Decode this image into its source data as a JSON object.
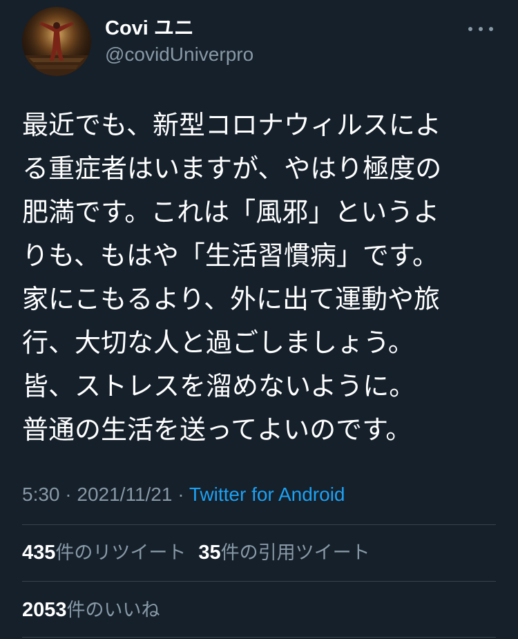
{
  "user": {
    "display_name": "Covi ユニ",
    "handle": "@covidUniverpro"
  },
  "tweet": {
    "lines": [
      "最近でも、新型コロナウィルスによ",
      "る重症者はいますが、やはり極度の",
      "肥満です。これは「風邪」というよ",
      "りも、もはや「生活習慣病」です。",
      "家にこもるより、外に出て運動や旅",
      "行、大切な人と過ごしましょう。",
      "皆、ストレスを溜めないように。",
      "普通の生活を送ってよいのです。"
    ]
  },
  "meta": {
    "time": "5:30",
    "separator": " · ",
    "date": "2021/11/21",
    "separator2": " · ",
    "source": "Twitter for Android"
  },
  "stats": {
    "retweets_count": "435",
    "retweets_label": "件のリツイート",
    "quotes_count": "35",
    "quotes_label": "件の引用ツイート",
    "likes_count": "2053",
    "likes_label": "件のいいね"
  },
  "icons": {
    "more": "more-options-icon"
  },
  "colors": {
    "background": "#15202b",
    "text": "#ffffff",
    "secondary": "#8899a6",
    "link": "#1da1f2",
    "divider": "#38444d"
  }
}
